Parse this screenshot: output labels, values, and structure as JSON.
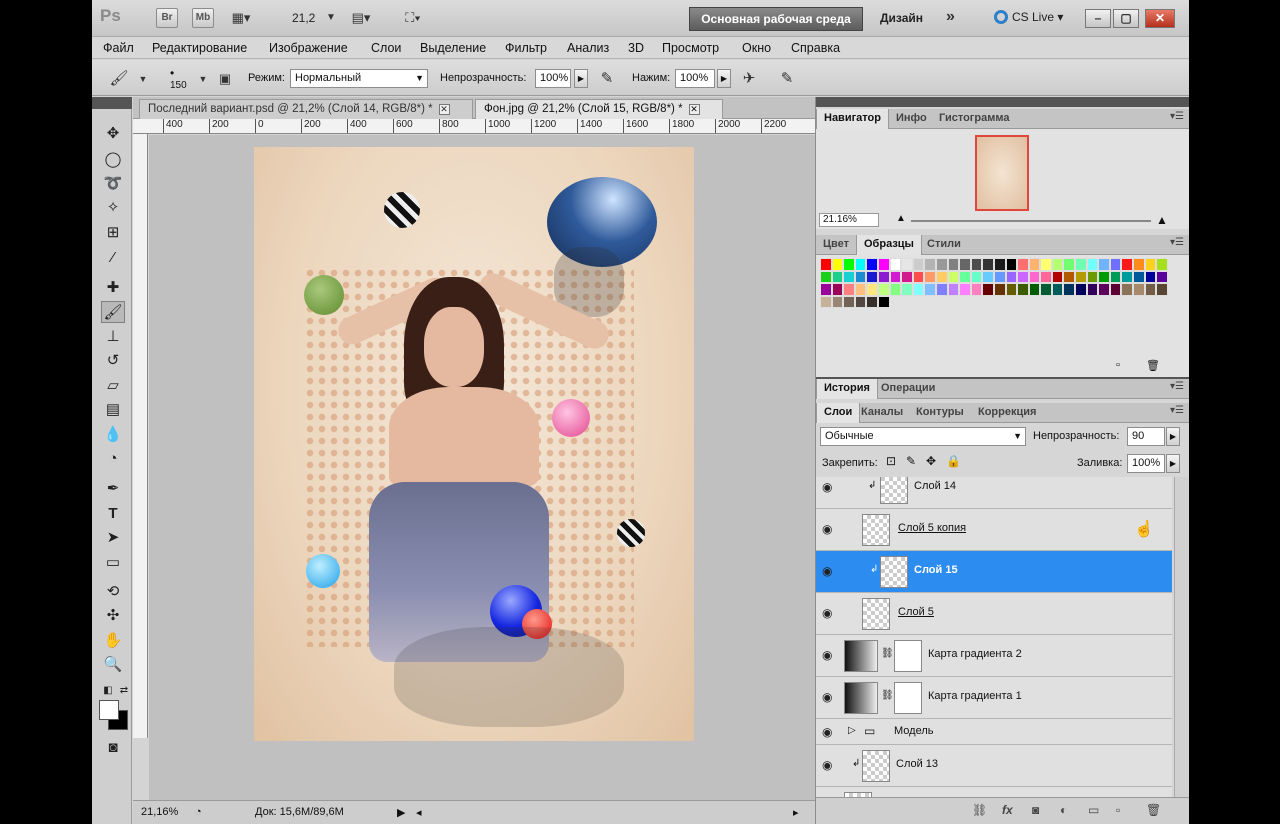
{
  "appbar": {
    "logo": "Ps",
    "bridge": "Br",
    "minibridge": "Mb",
    "zoom": "21,2",
    "workspace": "Основная рабочая среда",
    "design": "Дизайн",
    "more": "»",
    "cslive": "CS Live",
    "win_min": "–",
    "win_max": "▢",
    "win_close": "✕"
  },
  "menu": [
    "Файл",
    "Редактирование",
    "Изображение",
    "Слои",
    "Выделение",
    "Фильтр",
    "Анализ",
    "3D",
    "Просмотр",
    "Окно",
    "Справка"
  ],
  "options": {
    "brush_size": "150",
    "mode_label": "Режим:",
    "mode_value": "Нормальный",
    "opacity_label": "Непрозрачность:",
    "opacity_value": "100%",
    "pressure_label": "Нажим:",
    "pressure_value": "100%"
  },
  "document": {
    "tabs": [
      {
        "label": "Последний вариант.psd @ 21,2% (Слой 14, RGB/8*) *",
        "close": "✕"
      },
      {
        "label": "Фон.jpg @ 21,2% (Слой 15, RGB/8*) *",
        "close": "✕"
      }
    ],
    "ruler_labels": [
      "400",
      "200",
      "0",
      "200",
      "400",
      "600",
      "800",
      "1000",
      "1200",
      "1400",
      "1600",
      "1800",
      "2000",
      "2200"
    ],
    "status_zoom": "21,16%",
    "status_doc": "Док: 15,6M/89,6M"
  },
  "navigator": {
    "tabs": [
      "Навигатор",
      "Инфо",
      "Гистограмма"
    ],
    "zoom": "21.16%"
  },
  "swatches": {
    "tabs": [
      "Цвет",
      "Образцы",
      "Стили"
    ],
    "colors": [
      "#ff0000",
      "#ffff00",
      "#00ff00",
      "#00ffff",
      "#0000ff",
      "#ff00ff",
      "#ffffff",
      "#e6e6e6",
      "#cccccc",
      "#b3b3b3",
      "#999999",
      "#808080",
      "#666666",
      "#4d4d4d",
      "#333333",
      "#1a1a1a",
      "#000000",
      "#ff6f6f",
      "#ffb36f",
      "#ffff6f",
      "#b3ff6f",
      "#6fff6f",
      "#6fffb3",
      "#6fffff",
      "#6fb3ff",
      "#6f6fff",
      "#ff1a1a",
      "#ff8c1a",
      "#ffd11a",
      "#a6e01a",
      "#1ad11a",
      "#1ad18c",
      "#1ad1d1",
      "#1a8cd1",
      "#1a1ad1",
      "#8c1ad1",
      "#d11ad1",
      "#d11a8c",
      "#ff4d4d",
      "#ff9966",
      "#ffcc66",
      "#ccff66",
      "#66ff99",
      "#66ffcc",
      "#66ccff",
      "#6699ff",
      "#9966ff",
      "#cc66ff",
      "#ff66cc",
      "#ff6699",
      "#b30000",
      "#b35900",
      "#b39b00",
      "#6b9b00",
      "#009b00",
      "#009b59",
      "#009b9b",
      "#00599b",
      "#00009b",
      "#59009b",
      "#9b009b",
      "#9b0059",
      "#ff8080",
      "#ffbf80",
      "#ffe680",
      "#bfff80",
      "#80ff80",
      "#80ffbf",
      "#80ffff",
      "#80bfff",
      "#8080ff",
      "#bf80ff",
      "#ff80ff",
      "#ff80bf",
      "#660000",
      "#663300",
      "#665c00",
      "#3d5c00",
      "#005c00",
      "#005c33",
      "#005c5c",
      "#00335c",
      "#00005c",
      "#33005c",
      "#5c005c",
      "#5c0033",
      "#8c7358",
      "#a68a6b",
      "#735c45",
      "#594632",
      "#c7b299",
      "#998675",
      "#736357",
      "#534741",
      "#37302a",
      "#000000"
    ]
  },
  "history": {
    "tabs": [
      "История",
      "Операции"
    ]
  },
  "layers": {
    "tabs": [
      "Слои",
      "Каналы",
      "Контуры",
      "Коррекция"
    ],
    "blend_mode": "Обычные",
    "opacity_label": "Непрозрачность:",
    "opacity_value": "90",
    "lock_label": "Закрепить:",
    "fill_label": "Заливка:",
    "fill_value": "100%",
    "items": [
      {
        "name": "Слой 14"
      },
      {
        "name": "Слой 5 копия"
      },
      {
        "name": "Слой 15"
      },
      {
        "name": "Слой 5"
      },
      {
        "name": "Карта градиента 2"
      },
      {
        "name": "Карта градиента 1"
      },
      {
        "name": "Модель"
      },
      {
        "name": "Слой 13"
      }
    ]
  }
}
